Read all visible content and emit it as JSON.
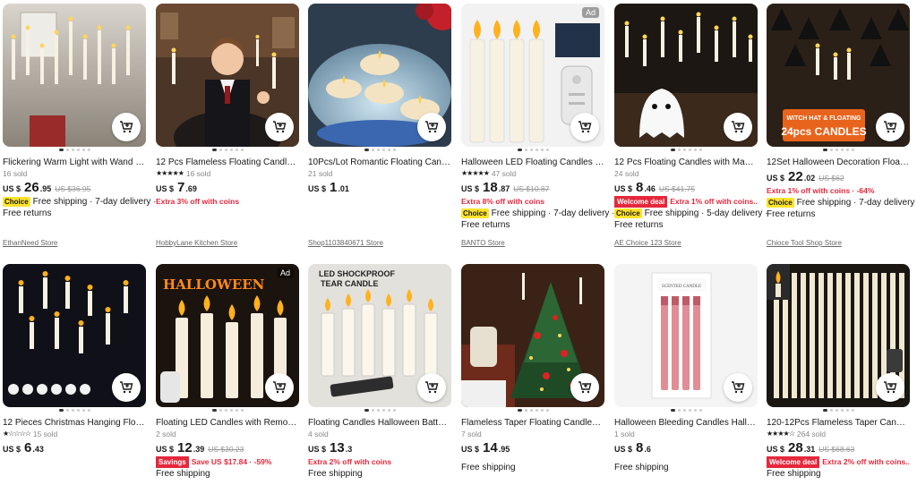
{
  "row1": [
    {
      "title": "Flickering Warm Light with Wand LE...",
      "sold": "16 sold",
      "currency": "US $",
      "price": "26",
      "cents": ".95",
      "old": "US $36.95",
      "promo": "",
      "choice": "Choice",
      "ship": "Free shipping · 7-day delivery ·",
      "returns": "Free returns",
      "store": "EthanNeed Store",
      "ad": ""
    },
    {
      "title": "12 Pcs Flameless Floating Candles ...",
      "stars": "★★★★★",
      "sold": "16 sold",
      "currency": "US $",
      "price": "7",
      "cents": ".69",
      "old": "",
      "promo": "Extra 3% off with coins",
      "choice": "",
      "ship": "",
      "returns": "",
      "store": "HobbyLane Kitchen Store",
      "ad": ""
    },
    {
      "title": "10Pcs/Lot Romantic Floating Candle...",
      "sold": "21 sold",
      "currency": "US $",
      "price": "1",
      "cents": ".01",
      "old": "",
      "promo": "",
      "choice": "",
      "ship": "",
      "returns": "",
      "store": "Shop1103840671 Store",
      "ad": ""
    },
    {
      "title": "Halloween LED Floating Candles Ma...",
      "stars": "★★★★★",
      "sold": "47 sold",
      "currency": "US $",
      "price": "18",
      "cents": ".87",
      "old": "US $10.87",
      "promo": "Extra 8% off with coins",
      "choice": "Choice",
      "ship": "Free shipping · 7-day delivery ·",
      "returns": "Free returns",
      "store": "BANTO Store",
      "ad": "Ad"
    },
    {
      "title": "12 Pcs Floating Candles with Magic ...",
      "sold": "24 sold",
      "currency": "US $",
      "price": "8",
      "cents": ".46",
      "old": "US $41.75",
      "welcome": "Welcome deal",
      "promo": "Extra 1% off with coins...",
      "choice": "Choice",
      "ship": "Free shipping · 5-day delivery ·",
      "returns": "Free returns",
      "store": "AE Choice 123 Store",
      "ad": ""
    },
    {
      "title": "12Set Halloween Decoration Floatin...",
      "sold": "",
      "currency": "US $",
      "price": "22",
      "cents": ".02",
      "old": "US $62",
      "promo": "Extra 1% off with coins · -64%",
      "choice": "Choice",
      "ship": "Free shipping · 7-day delivery ·",
      "returns": "Free returns",
      "store": "Chioce Tool Shop Store",
      "ad": ""
    }
  ],
  "row2": [
    {
      "title": "12 Pieces Christmas Hanging Floatin...",
      "stars": "★☆☆☆☆",
      "sold": "15 sold",
      "currency": "US $",
      "price": "6",
      "cents": ".43",
      "old": "",
      "promo": "",
      "ship": "",
      "ad": ""
    },
    {
      "title": "Floating LED Candles with Remote C...",
      "sold": "2 sold",
      "currency": "US $",
      "price": "12",
      "cents": ".39",
      "old": "US $30.23",
      "savings": "Savings",
      "promo": "Save US $17.84 · -59%",
      "ship": "Free shipping",
      "ad": "Ad"
    },
    {
      "title": "Floating Candles Halloween Battery ...",
      "sold": "4 sold",
      "currency": "US $",
      "price": "13",
      "cents": ".3",
      "old": "",
      "promo": "Extra 2% off with coins",
      "ship": "Free shipping",
      "ad": ""
    },
    {
      "title": "Flameless Taper Floating Candles wi...",
      "sold": "7 sold",
      "currency": "US $",
      "price": "14",
      "cents": ".95",
      "old": "",
      "promo": "",
      "ship": "Free shipping",
      "ad": ""
    },
    {
      "title": "Halloween Bleeding Candles Hallow...",
      "sold": "1 sold",
      "currency": "US $",
      "price": "8",
      "cents": ".6",
      "old": "",
      "promo": "",
      "ship": "Free shipping",
      "ad": ""
    },
    {
      "title": "120-12Pcs Flameless Taper Candles ...",
      "stars": "★★★★☆",
      "sold": "264 sold",
      "currency": "US $",
      "price": "28",
      "cents": ".31",
      "old": "US $68.63",
      "welcome": "Welcome deal",
      "promo": "Extra 2% off with coins...",
      "ship": "Free shipping",
      "ad": ""
    }
  ],
  "overlays": {
    "r1c6_banner": "WITCH HAT & FLOATING CANDLES 24pcs",
    "r2c2_banner": "HALLOWEEN",
    "r2c3_banner": "LED SHOCKPROOF TEAR CANDLE",
    "r2c5_box": "SCENTED CANDLE"
  }
}
